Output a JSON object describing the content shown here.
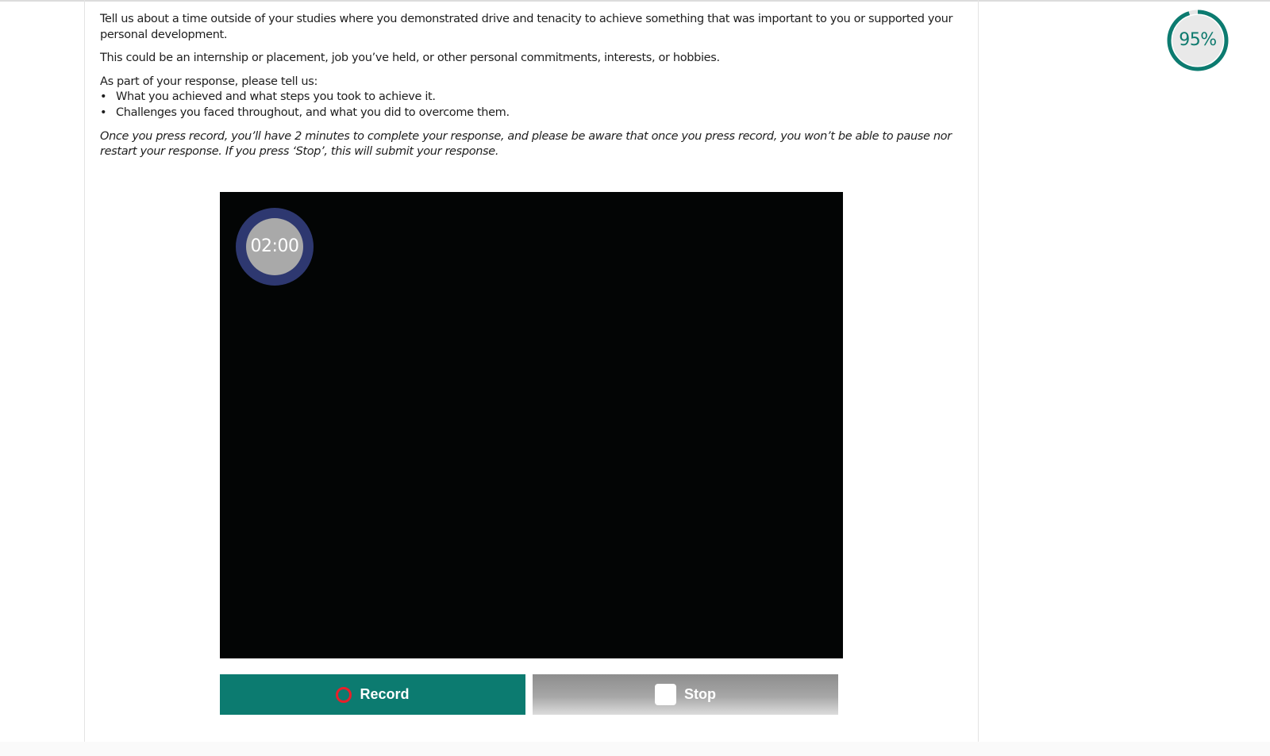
{
  "question": {
    "intro": "Tell us about a time outside of your studies where you demonstrated drive and tenacity to achieve something that was important to you or supported your personal development.",
    "examples": "This could be an internship or placement, job you’ve held, or other personal commitments, interests, or hobbies.",
    "prompt_label": "As part of your response, please tell us:",
    "bullet_glyph": "•",
    "bullets": [
      "What you achieved and what steps you took to achieve it.",
      "Challenges you faced throughout, and what you did to overcome them."
    ],
    "note": "Once you press record, you’ll have 2 minutes to complete your response, and please be aware that once you press record, you won’t be able to pause nor restart your response. If you press ‘Stop’, this will submit your response."
  },
  "video": {
    "timer": "02:00",
    "timer_icon": "countdown-timer"
  },
  "controls": {
    "record_label": "Record",
    "record_icon": "record-circle-icon",
    "stop_label": "Stop",
    "stop_icon": "stop-square-icon"
  },
  "progress": {
    "label": "95%",
    "value": 0.95
  },
  "colors": {
    "accent": "#0c7b70",
    "record_red": "#e8202a",
    "timer_ring": "#2e3870",
    "timer_fill": "#a9a9a9",
    "video_bg": "#030505",
    "progress_track": "#e6e6e6"
  }
}
